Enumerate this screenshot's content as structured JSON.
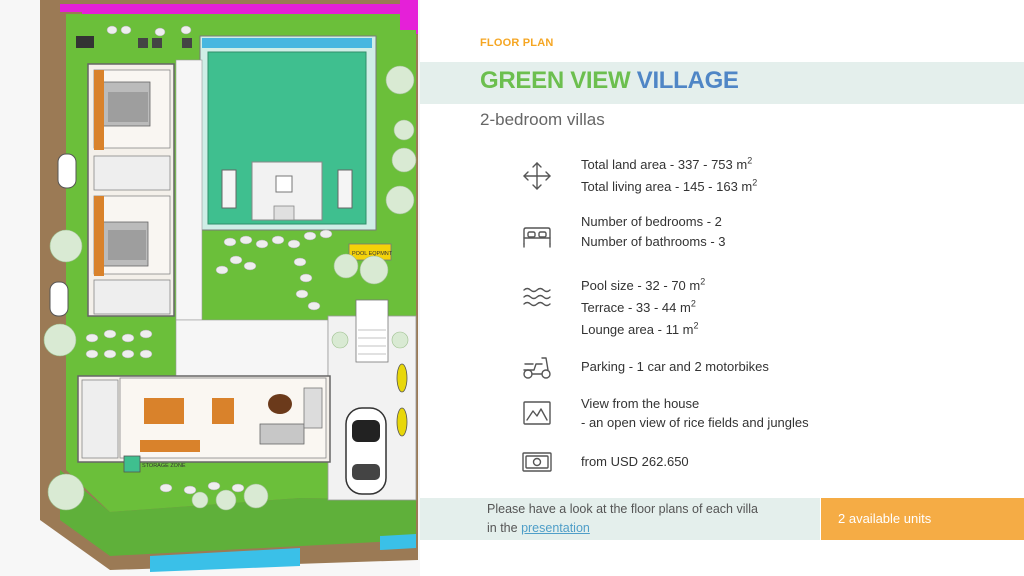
{
  "header": {
    "section_label": "FLOOR PLAN",
    "title_part1": "GREEN VIEW",
    "title_part2": "VILLAGE",
    "subtitle": "2-bedroom villas"
  },
  "plan": {
    "pool_equipment_label": "POOL EQPMNT",
    "storage_label": "STORAGE ZONE"
  },
  "features": {
    "area": {
      "icon": "arrows-expand-icon",
      "land_area": "Total land area - 337 - 753 m",
      "living_area": "Total living area - 145 - 163 m",
      "sup": "2"
    },
    "rooms": {
      "icon": "bed-icon",
      "bedrooms": "Number of bedrooms - 2",
      "bathrooms": "Number of bathrooms - 3"
    },
    "pool": {
      "icon": "waves-icon",
      "pool_size": "Pool size - 32 - 70 m",
      "terrace": "Terrace - 33 - 44 m",
      "lounge": "Lounge area - 11 m",
      "sup": "2"
    },
    "parking": {
      "icon": "scooter-icon",
      "text": "Parking - 1 car and 2 motorbikes"
    },
    "view": {
      "icon": "landscape-picture-icon",
      "line1": "View from the house",
      "line2": " - an open view of rice fields and jungles"
    },
    "price": {
      "icon": "banknote-icon",
      "text": "from USD 262.650"
    }
  },
  "footer": {
    "text_line1": "Please have a look at the floor plans of each villa",
    "text_line2_prefix": "in the ",
    "link_text": "presentation",
    "units_badge": "2 available units"
  },
  "colors": {
    "accent_orange": "#f5a623",
    "title_green": "#6cbf4f",
    "title_blue": "#4f86c6",
    "band_bg": "#e4efec",
    "lawn": "#6bbf3a",
    "pool": "#3fbf8f",
    "wall_magenta": "#e520d8"
  }
}
